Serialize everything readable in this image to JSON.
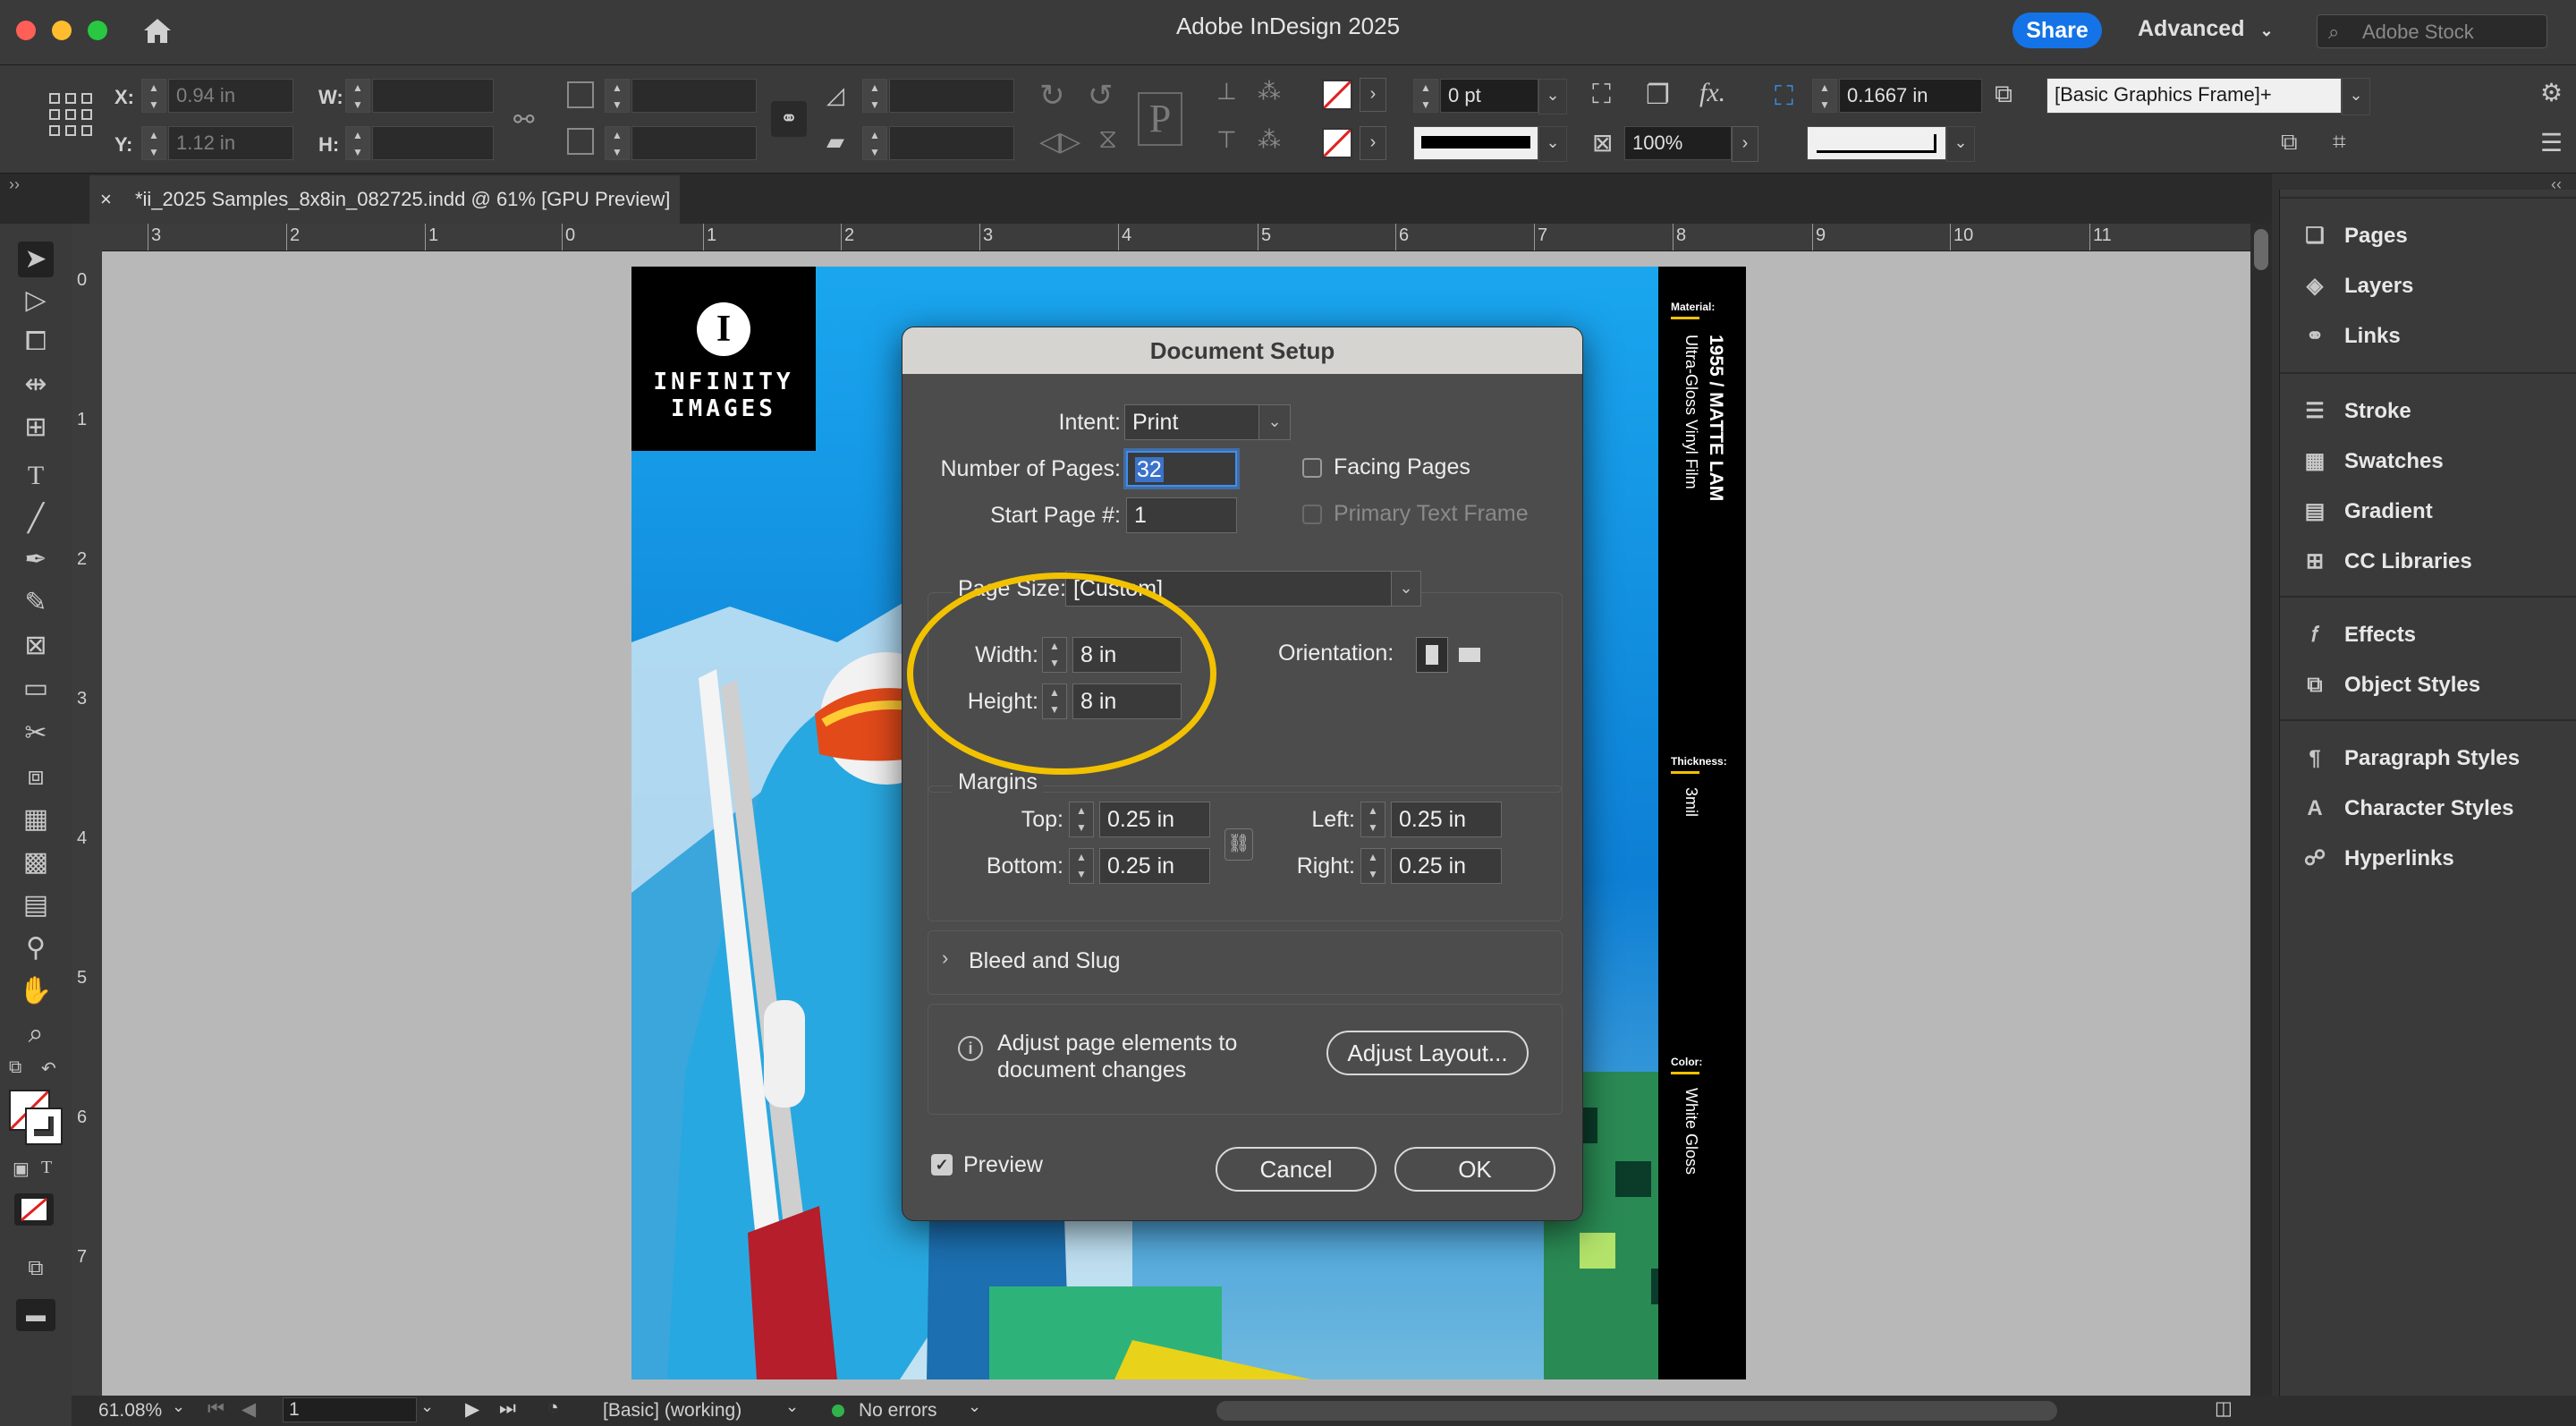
{
  "app": {
    "title": "Adobe InDesign 2025",
    "share_label": "Share",
    "workspace": "Advanced",
    "stock_placeholder": "Adobe Stock"
  },
  "control_bar": {
    "x_label": "X:",
    "x_value": "0.94 in",
    "y_label": "Y:",
    "y_value": "1.12 in",
    "w_label": "W:",
    "h_label": "H:",
    "stroke_weight": "0 pt",
    "opacity": "100%",
    "corner_value": "0.1667 in",
    "object_style": "[Basic Graphics Frame]+",
    "p_glyph": "P",
    "fx_glyph": "fx."
  },
  "document_tab": {
    "close": "×",
    "label": "*ii_2025 Samples_8x8in_082725.indd @ 61% [GPU Preview]"
  },
  "rulers": {
    "h_ticks": [
      "3",
      "2",
      "1",
      "0",
      "1",
      "2",
      "3",
      "4",
      "5",
      "6",
      "7",
      "8",
      "9",
      "10",
      "11"
    ],
    "v_ticks": [
      "0",
      "1",
      "2",
      "3",
      "4",
      "5",
      "6",
      "7"
    ]
  },
  "page": {
    "logo_line1": "INFINITY",
    "logo_line2": "IMAGES",
    "logo_glyph": "I",
    "side_material_label": "Material:",
    "side_material_value": "1955 / MATTE LAM",
    "side_material_sub": "Ultra-Gloss Vinyl Film",
    "side_thickness_label": "Thickness:",
    "side_thickness_value": "3mil",
    "side_color_label": "Color:",
    "side_color_value": "White Gloss"
  },
  "panels": [
    {
      "label": "Pages",
      "icon": "pages-icon"
    },
    {
      "label": "Layers",
      "icon": "layers-icon"
    },
    {
      "label": "Links",
      "icon": "links-icon"
    },
    {
      "label": "Stroke",
      "icon": "stroke-icon"
    },
    {
      "label": "Swatches",
      "icon": "swatches-icon"
    },
    {
      "label": "Gradient",
      "icon": "gradient-icon"
    },
    {
      "label": "CC Libraries",
      "icon": "cc-libraries-icon"
    },
    {
      "label": "Effects",
      "icon": "effects-icon"
    },
    {
      "label": "Object Styles",
      "icon": "object-styles-icon"
    },
    {
      "label": "Paragraph Styles",
      "icon": "paragraph-styles-icon"
    },
    {
      "label": "Character Styles",
      "icon": "character-styles-icon"
    },
    {
      "label": "Hyperlinks",
      "icon": "hyperlinks-icon"
    }
  ],
  "dialog": {
    "title": "Document Setup",
    "intent_label": "Intent:",
    "intent_value": "Print",
    "pages_label": "Number of Pages:",
    "pages_value": "32",
    "start_label": "Start Page #:",
    "start_value": "1",
    "facing_label": "Facing Pages",
    "primary_label": "Primary Text Frame",
    "pagesize_label": "Page Size:",
    "pagesize_value": "[Custom]",
    "width_label": "Width:",
    "width_value": "8 in",
    "height_label": "Height:",
    "height_value": "8 in",
    "orientation_label": "Orientation:",
    "margins_label": "Margins",
    "top_label": "Top:",
    "top_value": "0.25 in",
    "bottom_label": "Bottom:",
    "bottom_value": "0.25 in",
    "left_label": "Left:",
    "left_value": "0.25 in",
    "right_label": "Right:",
    "right_value": "0.25 in",
    "bleed_label": "Bleed and Slug",
    "adjust_text_1": "Adjust page elements to",
    "adjust_text_2": "document changes",
    "adjust_button": "Adjust Layout...",
    "preview_label": "Preview",
    "cancel_label": "Cancel",
    "ok_label": "OK"
  },
  "status": {
    "zoom": "61.08%",
    "page": "1",
    "master": "[Basic] (working)",
    "errors": "No errors"
  },
  "colors": {
    "accent": "#1473e6",
    "highlight_circle": "#f2c200",
    "page_blue": "#1aa6ef"
  }
}
